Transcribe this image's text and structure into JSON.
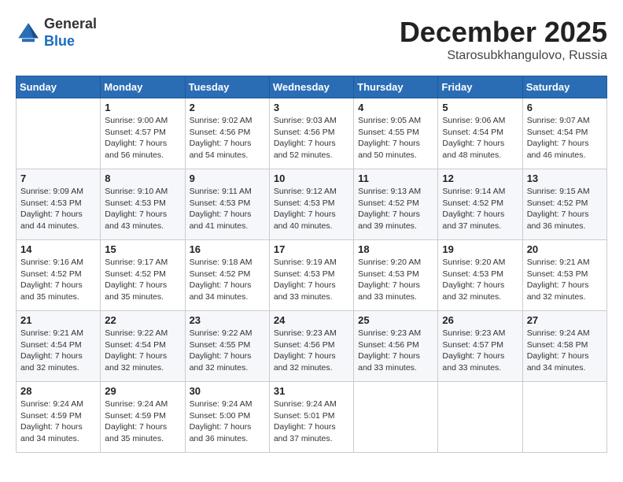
{
  "logo": {
    "general": "General",
    "blue": "Blue"
  },
  "header": {
    "month": "December 2025",
    "location": "Starosubkhangulovo, Russia"
  },
  "weekdays": [
    "Sunday",
    "Monday",
    "Tuesday",
    "Wednesday",
    "Thursday",
    "Friday",
    "Saturday"
  ],
  "weeks": [
    [
      {
        "day": "",
        "sunrise": "",
        "sunset": "",
        "daylight": ""
      },
      {
        "day": "1",
        "sunrise": "Sunrise: 9:00 AM",
        "sunset": "Sunset: 4:57 PM",
        "daylight": "Daylight: 7 hours and 56 minutes."
      },
      {
        "day": "2",
        "sunrise": "Sunrise: 9:02 AM",
        "sunset": "Sunset: 4:56 PM",
        "daylight": "Daylight: 7 hours and 54 minutes."
      },
      {
        "day": "3",
        "sunrise": "Sunrise: 9:03 AM",
        "sunset": "Sunset: 4:56 PM",
        "daylight": "Daylight: 7 hours and 52 minutes."
      },
      {
        "day": "4",
        "sunrise": "Sunrise: 9:05 AM",
        "sunset": "Sunset: 4:55 PM",
        "daylight": "Daylight: 7 hours and 50 minutes."
      },
      {
        "day": "5",
        "sunrise": "Sunrise: 9:06 AM",
        "sunset": "Sunset: 4:54 PM",
        "daylight": "Daylight: 7 hours and 48 minutes."
      },
      {
        "day": "6",
        "sunrise": "Sunrise: 9:07 AM",
        "sunset": "Sunset: 4:54 PM",
        "daylight": "Daylight: 7 hours and 46 minutes."
      }
    ],
    [
      {
        "day": "7",
        "sunrise": "Sunrise: 9:09 AM",
        "sunset": "Sunset: 4:53 PM",
        "daylight": "Daylight: 7 hours and 44 minutes."
      },
      {
        "day": "8",
        "sunrise": "Sunrise: 9:10 AM",
        "sunset": "Sunset: 4:53 PM",
        "daylight": "Daylight: 7 hours and 43 minutes."
      },
      {
        "day": "9",
        "sunrise": "Sunrise: 9:11 AM",
        "sunset": "Sunset: 4:53 PM",
        "daylight": "Daylight: 7 hours and 41 minutes."
      },
      {
        "day": "10",
        "sunrise": "Sunrise: 9:12 AM",
        "sunset": "Sunset: 4:53 PM",
        "daylight": "Daylight: 7 hours and 40 minutes."
      },
      {
        "day": "11",
        "sunrise": "Sunrise: 9:13 AM",
        "sunset": "Sunset: 4:52 PM",
        "daylight": "Daylight: 7 hours and 39 minutes."
      },
      {
        "day": "12",
        "sunrise": "Sunrise: 9:14 AM",
        "sunset": "Sunset: 4:52 PM",
        "daylight": "Daylight: 7 hours and 37 minutes."
      },
      {
        "day": "13",
        "sunrise": "Sunrise: 9:15 AM",
        "sunset": "Sunset: 4:52 PM",
        "daylight": "Daylight: 7 hours and 36 minutes."
      }
    ],
    [
      {
        "day": "14",
        "sunrise": "Sunrise: 9:16 AM",
        "sunset": "Sunset: 4:52 PM",
        "daylight": "Daylight: 7 hours and 35 minutes."
      },
      {
        "day": "15",
        "sunrise": "Sunrise: 9:17 AM",
        "sunset": "Sunset: 4:52 PM",
        "daylight": "Daylight: 7 hours and 35 minutes."
      },
      {
        "day": "16",
        "sunrise": "Sunrise: 9:18 AM",
        "sunset": "Sunset: 4:52 PM",
        "daylight": "Daylight: 7 hours and 34 minutes."
      },
      {
        "day": "17",
        "sunrise": "Sunrise: 9:19 AM",
        "sunset": "Sunset: 4:53 PM",
        "daylight": "Daylight: 7 hours and 33 minutes."
      },
      {
        "day": "18",
        "sunrise": "Sunrise: 9:20 AM",
        "sunset": "Sunset: 4:53 PM",
        "daylight": "Daylight: 7 hours and 33 minutes."
      },
      {
        "day": "19",
        "sunrise": "Sunrise: 9:20 AM",
        "sunset": "Sunset: 4:53 PM",
        "daylight": "Daylight: 7 hours and 32 minutes."
      },
      {
        "day": "20",
        "sunrise": "Sunrise: 9:21 AM",
        "sunset": "Sunset: 4:53 PM",
        "daylight": "Daylight: 7 hours and 32 minutes."
      }
    ],
    [
      {
        "day": "21",
        "sunrise": "Sunrise: 9:21 AM",
        "sunset": "Sunset: 4:54 PM",
        "daylight": "Daylight: 7 hours and 32 minutes."
      },
      {
        "day": "22",
        "sunrise": "Sunrise: 9:22 AM",
        "sunset": "Sunset: 4:54 PM",
        "daylight": "Daylight: 7 hours and 32 minutes."
      },
      {
        "day": "23",
        "sunrise": "Sunrise: 9:22 AM",
        "sunset": "Sunset: 4:55 PM",
        "daylight": "Daylight: 7 hours and 32 minutes."
      },
      {
        "day": "24",
        "sunrise": "Sunrise: 9:23 AM",
        "sunset": "Sunset: 4:56 PM",
        "daylight": "Daylight: 7 hours and 32 minutes."
      },
      {
        "day": "25",
        "sunrise": "Sunrise: 9:23 AM",
        "sunset": "Sunset: 4:56 PM",
        "daylight": "Daylight: 7 hours and 33 minutes."
      },
      {
        "day": "26",
        "sunrise": "Sunrise: 9:23 AM",
        "sunset": "Sunset: 4:57 PM",
        "daylight": "Daylight: 7 hours and 33 minutes."
      },
      {
        "day": "27",
        "sunrise": "Sunrise: 9:24 AM",
        "sunset": "Sunset: 4:58 PM",
        "daylight": "Daylight: 7 hours and 34 minutes."
      }
    ],
    [
      {
        "day": "28",
        "sunrise": "Sunrise: 9:24 AM",
        "sunset": "Sunset: 4:59 PM",
        "daylight": "Daylight: 7 hours and 34 minutes."
      },
      {
        "day": "29",
        "sunrise": "Sunrise: 9:24 AM",
        "sunset": "Sunset: 4:59 PM",
        "daylight": "Daylight: 7 hours and 35 minutes."
      },
      {
        "day": "30",
        "sunrise": "Sunrise: 9:24 AM",
        "sunset": "Sunset: 5:00 PM",
        "daylight": "Daylight: 7 hours and 36 minutes."
      },
      {
        "day": "31",
        "sunrise": "Sunrise: 9:24 AM",
        "sunset": "Sunset: 5:01 PM",
        "daylight": "Daylight: 7 hours and 37 minutes."
      },
      {
        "day": "",
        "sunrise": "",
        "sunset": "",
        "daylight": ""
      },
      {
        "day": "",
        "sunrise": "",
        "sunset": "",
        "daylight": ""
      },
      {
        "day": "",
        "sunrise": "",
        "sunset": "",
        "daylight": ""
      }
    ]
  ]
}
